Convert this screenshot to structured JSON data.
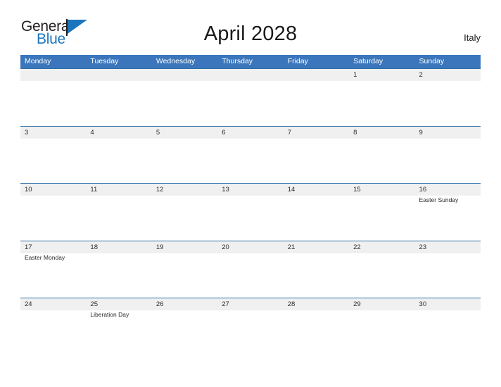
{
  "brand": {
    "name_part1": "General",
    "name_part2": "Blue",
    "logo_icon": "flag-triangle-icon"
  },
  "header": {
    "title": "April 2028",
    "country": "Italy"
  },
  "colors": {
    "header_blue": "#3b76bc",
    "row_rule_blue": "#2e6da4",
    "day_strip_gray": "#f0f0f0",
    "logo_blue": "#1b75bc",
    "text": "#2b2b2b",
    "page_background": "#ffffff"
  },
  "calendar": {
    "month": "April",
    "year": "2028",
    "week_start": "Monday",
    "day_headers": [
      "Monday",
      "Tuesday",
      "Wednesday",
      "Thursday",
      "Friday",
      "Saturday",
      "Sunday"
    ],
    "weeks": [
      [
        {
          "date": "",
          "event": ""
        },
        {
          "date": "",
          "event": ""
        },
        {
          "date": "",
          "event": ""
        },
        {
          "date": "",
          "event": ""
        },
        {
          "date": "",
          "event": ""
        },
        {
          "date": "1",
          "event": ""
        },
        {
          "date": "2",
          "event": ""
        }
      ],
      [
        {
          "date": "3",
          "event": ""
        },
        {
          "date": "4",
          "event": ""
        },
        {
          "date": "5",
          "event": ""
        },
        {
          "date": "6",
          "event": ""
        },
        {
          "date": "7",
          "event": ""
        },
        {
          "date": "8",
          "event": ""
        },
        {
          "date": "9",
          "event": ""
        }
      ],
      [
        {
          "date": "10",
          "event": ""
        },
        {
          "date": "11",
          "event": ""
        },
        {
          "date": "12",
          "event": ""
        },
        {
          "date": "13",
          "event": ""
        },
        {
          "date": "14",
          "event": ""
        },
        {
          "date": "15",
          "event": ""
        },
        {
          "date": "16",
          "event": "Easter Sunday"
        }
      ],
      [
        {
          "date": "17",
          "event": "Easter Monday"
        },
        {
          "date": "18",
          "event": ""
        },
        {
          "date": "19",
          "event": ""
        },
        {
          "date": "20",
          "event": ""
        },
        {
          "date": "21",
          "event": ""
        },
        {
          "date": "22",
          "event": ""
        },
        {
          "date": "23",
          "event": ""
        }
      ],
      [
        {
          "date": "24",
          "event": ""
        },
        {
          "date": "25",
          "event": "Liberation Day"
        },
        {
          "date": "26",
          "event": ""
        },
        {
          "date": "27",
          "event": ""
        },
        {
          "date": "28",
          "event": ""
        },
        {
          "date": "29",
          "event": ""
        },
        {
          "date": "30",
          "event": ""
        }
      ]
    ]
  }
}
